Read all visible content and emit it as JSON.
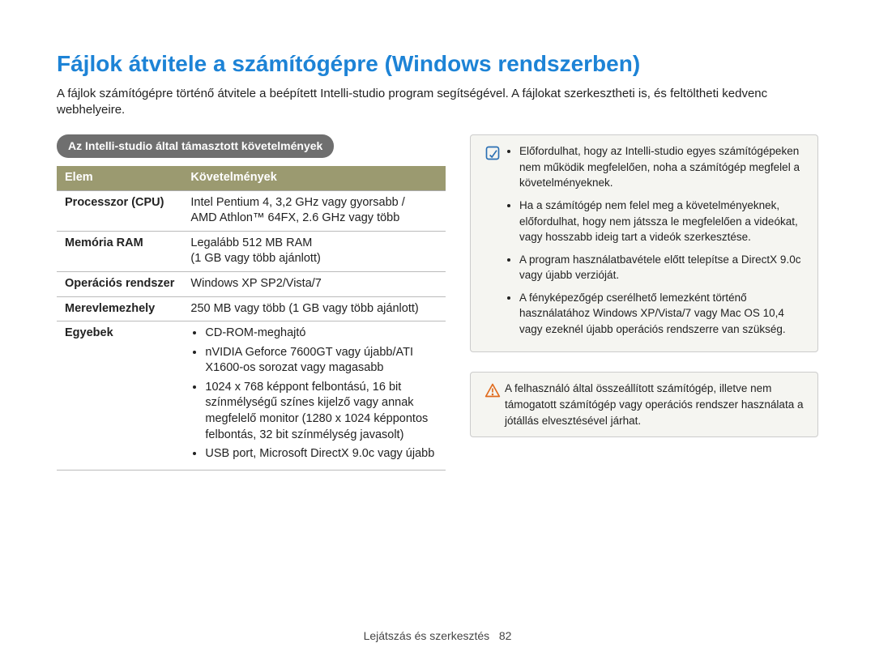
{
  "title": "Fájlok átvitele a számítógépre (Windows rendszerben)",
  "intro": "A fájlok számítógépre történő átvitele a beépített Intelli-studio program segítségével. A fájlokat szerkesztheti is, és feltöltheti kedvenc webhelyeire.",
  "section_title": "Az Intelli-studio által támasztott követelmények",
  "table": {
    "headers": {
      "col1": "Elem",
      "col2": "Követelmények"
    },
    "rows": {
      "cpu": {
        "label": "Processzor (CPU)",
        "line1": "Intel Pentium 4, 3,2 GHz vagy gyorsabb /",
        "line2": "AMD Athlon™ 64FX, 2.6 GHz vagy több"
      },
      "ram": {
        "label": "Memória RAM",
        "line1": "Legalább 512 MB RAM",
        "line2": "(1 GB vagy több ajánlott)"
      },
      "os": {
        "label": "Operációs rendszer",
        "value": "Windows XP SP2/Vista/7"
      },
      "hdd": {
        "label": "Merevlemezhely",
        "value": "250 MB vagy több (1 GB vagy több ajánlott)"
      },
      "other": {
        "label": "Egyebek",
        "items": {
          "i1": "CD-ROM-meghajtó",
          "i2": "nVIDIA Geforce 7600GT vagy újabb/ATI X1600-os sorozat vagy magasabb",
          "i3": "1024 x 768 képpont felbontású, 16 bit színmélységű színes kijelző vagy annak megfelelő monitor (1280 x 1024 képpontos felbontás, 32 bit színmélység javasolt)",
          "i4": "USB port, Microsoft DirectX 9.0c vagy újabb"
        }
      }
    }
  },
  "info_notes": {
    "n1": "Előfordulhat, hogy az Intelli-studio egyes számítógépeken nem működik megfelelően, noha a számítógép megfelel a követelményeknek.",
    "n2": "Ha a számítógép nem felel meg a követelményeknek, előfordulhat, hogy nem játssza le megfelelően a videókat, vagy hosszabb ideig tart a videók szerkesztése.",
    "n3": "A program használatbavétele előtt telepítse a DirectX 9.0c vagy újabb verzióját.",
    "n4": "A fényképezőgép cserélhető lemezként történő használatához Windows XP/Vista/7 vagy Mac OS 10,4 vagy ezeknél újabb operációs rendszerre van szükség."
  },
  "warn_note": "A felhasználó által összeállított számítógép, illetve nem támogatott számítógép vagy operációs rendszer használata a jótállás elvesztésével járhat.",
  "footer": {
    "section": "Lejátszás és szerkesztés",
    "page": "82"
  }
}
